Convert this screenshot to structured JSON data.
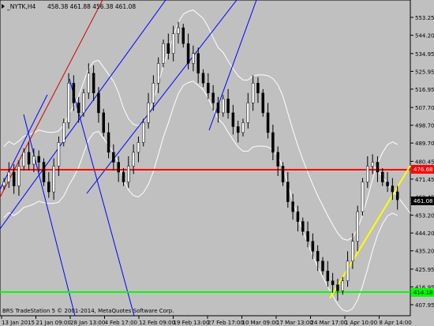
{
  "header": {
    "symbol_tf": "_NYTK,H4",
    "ohlc": "458.38 461.88 456.38 461.08"
  },
  "copyright": "BRS TradeStation 5 © 2001-2014, MetaQuotes Software Corp.",
  "price_axis": {
    "labels": [
      "553.25",
      "544.20",
      "534.95",
      "525.95",
      "516.95",
      "507.70",
      "498.70",
      "489.70",
      "480.45",
      "471.45",
      "462.45",
      "453.20",
      "444.20",
      "435.20",
      "425.95",
      "416.95",
      "407.95"
    ]
  },
  "time_axis": {
    "labels": [
      "13 Jan 2015",
      "21 Jan 09:00",
      "28 Jan 13:00",
      "4 Feb 17:00",
      "12 Feb 09:00",
      "19 Feb 13:00",
      "27 Feb 17:00",
      "10 Mar 09:00",
      "17 Mar 13:00",
      "24 Mar 17:00",
      "1 Apr 10:00",
      "8 Apr 14:00"
    ]
  },
  "markers": {
    "current_price": "461.08",
    "red_level": "476.68",
    "green_level": "414.18"
  },
  "colors": {
    "background": "#c0c0c0",
    "bull_candle": "#ffffff",
    "bear_candle": "#000000",
    "red_line": "#ff0000",
    "green_line": "#00ff00",
    "yellow_line": "#ffff00",
    "blue_line": "#0000ff",
    "envelope": "#ffffff"
  },
  "chart_data": {
    "type": "candlestick",
    "ylim": [
      407.95,
      553.25
    ],
    "closes": [
      470,
      475,
      468,
      478,
      485,
      479,
      483,
      480,
      470,
      465,
      478,
      490,
      500,
      520,
      510,
      505,
      515,
      525,
      515,
      505,
      495,
      485,
      480,
      475,
      470,
      478,
      485,
      490,
      500,
      510,
      520,
      530,
      540,
      535,
      545,
      548,
      540,
      530,
      535,
      525,
      520,
      515,
      510,
      505,
      512,
      505,
      498,
      495,
      500,
      510,
      520,
      515,
      505,
      495,
      485,
      478,
      470,
      460,
      455,
      450,
      445,
      440,
      435,
      430,
      425,
      420,
      418,
      415,
      420,
      430,
      440,
      455,
      470,
      478,
      480,
      475,
      470,
      468,
      465,
      461
    ]
  }
}
